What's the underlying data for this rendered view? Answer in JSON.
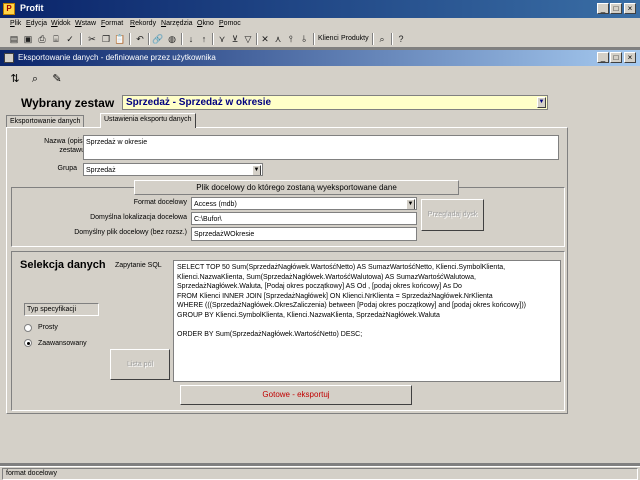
{
  "window": {
    "title": "Profit",
    "logo_text": "P"
  },
  "menu": [
    "Plik",
    "Edycja",
    "Widok",
    "Wstaw",
    "Format",
    "Rekordy",
    "Narzędzia",
    "Okno",
    "Pomoc"
  ],
  "toolbar": {
    "clients_label": "Klienci",
    "products_label": "Produkty"
  },
  "child_window": {
    "title": "Eksportowanie danych - definiowane przez użytkownika"
  },
  "form": {
    "set_heading": "Wybrany zestaw",
    "set_value": "Sprzedaż - Sprzedaż w okresie",
    "tabs": [
      {
        "label": "Eksportowanie danych"
      },
      {
        "label": "Ustawienia eksportu danych"
      }
    ],
    "name_label": "Nazwa (opis) zestawu",
    "name_value": "Sprzedaż w okresie",
    "group_label": "Grupa",
    "group_value": "Sprzedaż",
    "target_file_header": "Plik docelowy do którego zostaną wyeksportowane dane",
    "format_label": "Format docelowy",
    "format_value": "Access (mdb)",
    "location_label": "Domyślna lokalizacja docelowa",
    "location_value": "C:\\Bufor\\",
    "file_label": "Domyślny plik docelowy (bez rozsz.)",
    "file_value": "SprzedażWOkresie",
    "browse_button": "Przeglądaj dysk",
    "selection_heading": "Selekcja danych",
    "query_label": "Zapytanie SQL",
    "sql": "SELECT TOP 50 Sum(SprzedażNagłówek.WartośćNetto) AS SumazWartośćNetto, Klienci.SymbolKlienta, Klienci.NazwaKlienta, Sum(SprzedażNagłówek.WartośćWalutowa) AS SumazWartośćWalutowa, SprzedażNagłówek.Waluta, [Podaj okres początkowy] AS Od , [podaj okres końcowy] As Do\nFROM Klienci INNER JOIN [SprzedażNagłówek] ON Klienci.NrKlienta = SprzedażNagłówek.NrKlienta\nWHERE (((SprzedażNagłówek.OkresZaliczenia) between [Podaj okres początkowy] and [podaj okres końcowy]))\nGROUP BY Klienci.SymbolKlienta, Klienci.NazwaKlienta, SprzedażNagłówek.Waluta\n\nORDER BY Sum(SprzedażNagłówek.WartośćNetto) DESC;",
    "spec_type_label": "Typ specyfikacji",
    "radio_simple": "Prosty",
    "radio_advanced": "Zaawansowany",
    "field_list_button": "Lista pól",
    "export_button": "Gotowe - eksportuj"
  },
  "status_bar": {
    "text": "format docelowy"
  },
  "colors": {
    "title_start": "#0a246a",
    "title_end": "#3a6ea5",
    "face": "#d4d0c8",
    "combo_bg": "#ffffc8",
    "export_text": "#c00000"
  }
}
